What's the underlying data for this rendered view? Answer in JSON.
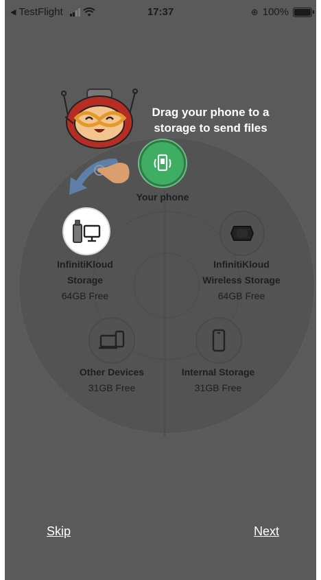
{
  "status_bar": {
    "back_app": "TestFlight",
    "time": "17:37",
    "battery_percent": "100%",
    "battery_level": 1.0
  },
  "onboarding": {
    "instruction": "Drag your phone to a storage to send files",
    "your_phone_label": "Your phone"
  },
  "storages": [
    {
      "name_line1": "InfinitiKloud",
      "name_line2": "Storage",
      "free": "64GB Free",
      "highlighted": true
    },
    {
      "name_line1": "InfinitiKloud",
      "name_line2": "Wireless Storage",
      "free": "64GB Free",
      "highlighted": false
    },
    {
      "name_line1": "Other Devices",
      "name_line2": "",
      "free": "31GB Free",
      "highlighted": false
    },
    {
      "name_line1": "Internal Storage",
      "name_line2": "",
      "free": "31GB Free",
      "highlighted": false
    }
  ],
  "footer": {
    "skip_label": "Skip",
    "next_label": "Next"
  },
  "colors": {
    "overlay": "#5a5a5a",
    "phone_accent": "#3fae62",
    "highlight": "#ffffff"
  }
}
